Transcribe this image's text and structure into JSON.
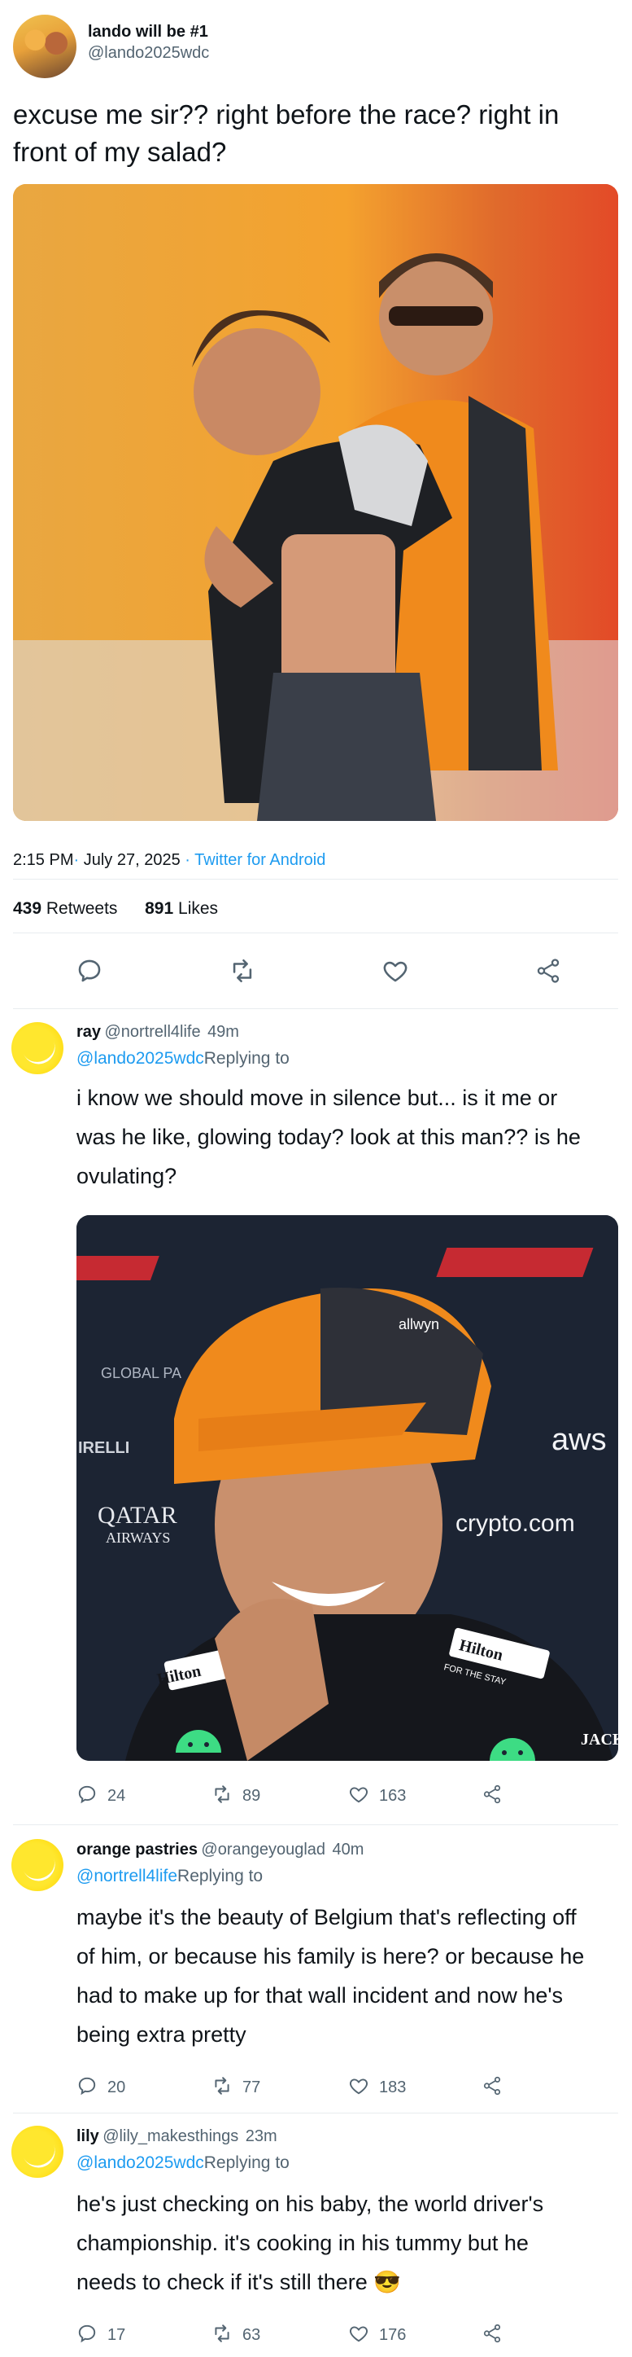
{
  "main_tweet": {
    "author_name": "lando will be #1",
    "author_handle": "@lando2025wdc",
    "text": "excuse me sir?? right before the race? right in front of my salad?",
    "time": "2:15 PM",
    "separator": "·",
    "date": "July 27, 2025",
    "source": "Twitter for Android",
    "retweets_count": "439",
    "retweets_label": "Retweets",
    "likes_count": "891",
    "likes_label": "Likes",
    "photo_icon": "photo-image"
  },
  "replies": [
    {
      "name": "ray",
      "handle": "@nortrell4life",
      "time": "49m",
      "mention": "@lando2025wdc",
      "replying": "Replying to",
      "text_lines": [
        "i know we should move in silence but... is it me or",
        "was he like, glowing today? look at this man?? is he",
        "ovulating?"
      ],
      "replies": "24",
      "retweets": "89",
      "likes": "163",
      "photo_texts": [
        "GLOBAL PA",
        "IRELLI",
        "QATAR",
        "AIRWAYS",
        "crypto.com",
        "aws",
        "allwyn",
        "Hilton",
        "FOR THE STAY",
        "JACK"
      ]
    },
    {
      "name": "orange pastries",
      "handle": "@orangeyouglad",
      "time": "40m",
      "mention": "@nortrell4life",
      "replying": "Replying to",
      "text_lines": [
        "maybe it's the beauty of Belgium that's reflecting off",
        "of him, or because his family is here? or because he",
        "had to make up for that wall incident and now he's",
        "being extra pretty"
      ],
      "replies": "20",
      "retweets": "77",
      "likes": "183"
    },
    {
      "name": "lily",
      "handle": "@lily_makesthings",
      "time": "23m",
      "mention": "@lando2025wdc",
      "replying": "Replying to",
      "text_lines": [
        "he's just checking on his baby, the world driver's",
        "championship. it's cooking in his tummy but he",
        "needs to check if it's still there 😎"
      ],
      "replies": "17",
      "retweets": "63",
      "likes": "176"
    }
  ],
  "colors": {
    "link_blue": "#1d9bf0",
    "secondary_gray": "#536471",
    "avatar_yellow": "#ffd400",
    "divider": "#e8ecef"
  },
  "icons": [
    "reply-icon",
    "retweet-icon",
    "like-icon",
    "share-icon",
    "android-icon"
  ]
}
